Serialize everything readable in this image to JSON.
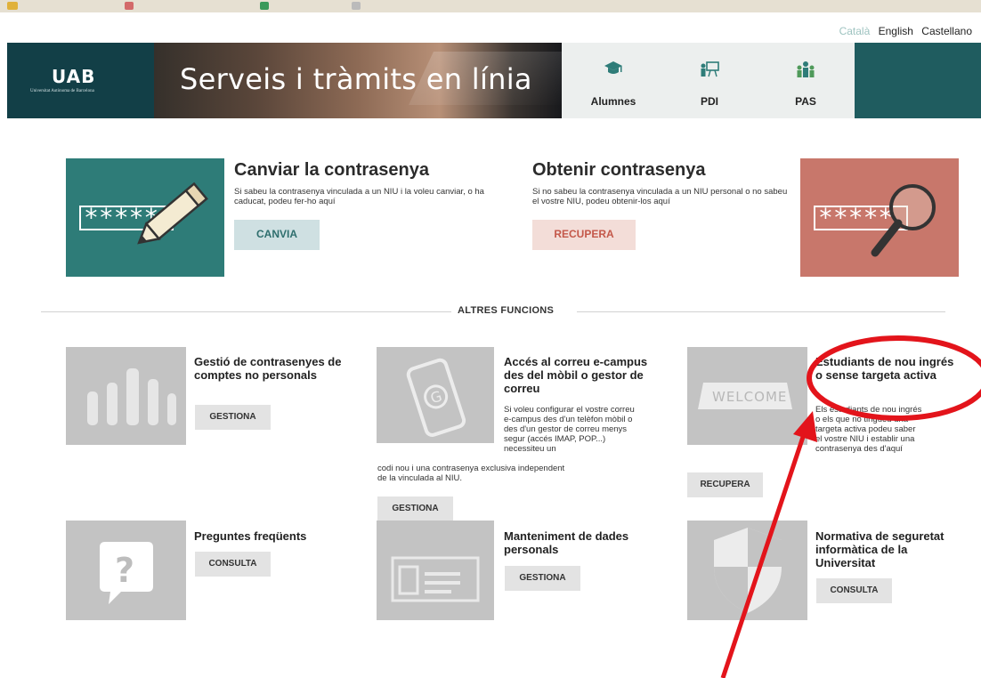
{
  "colors": {
    "teal_dark": "#123f47",
    "teal": "#2e7c78",
    "salmon": "#c8776b",
    "grey_tile": "#c3c3c3",
    "annotation_red": "#e3141b"
  },
  "languages": [
    {
      "label": "Català",
      "active": true
    },
    {
      "label": "English",
      "active": false
    },
    {
      "label": "Castellano",
      "active": false
    }
  ],
  "header": {
    "logo": "UAB",
    "logo_sub": "Universitat Autònoma de Barcelona",
    "title": "Serveis i tràmits en línia",
    "nav": [
      {
        "label": "Alumnes",
        "icon": "graduation-cap-icon"
      },
      {
        "label": "PDI",
        "icon": "teacher-board-icon"
      },
      {
        "label": "PAS",
        "icon": "staff-group-icon"
      }
    ]
  },
  "primary": {
    "canviar": {
      "title": "Canviar la contrasenya",
      "desc": "Si sabeu la contrasenya vinculada a un NIU i la voleu canviar, o ha caducat, podeu fer-ho aquí",
      "button": "CANVIA",
      "image_text": "*****"
    },
    "obtenir": {
      "title": "Obtenir contrasenya",
      "desc": "Si no sabeu la contrasenya vinculada a un NIU personal o no sabeu el vostre NIU, podeu obtenir-los aquí",
      "button": "RECUPERA",
      "image_text": "*****"
    }
  },
  "divider": "ALTRES FUNCIONS",
  "functions": {
    "gestio": {
      "title": "Gestió de contrasenyes de comptes no personals",
      "button": "GESTIONA"
    },
    "correu": {
      "title": "Accés al correu e-campus des del mòbil o gestor de correu",
      "desc": "Si voleu configurar el vostre correu e-campus des d'un telèfon mòbil o des d'un gestor de correu menys segur (accés IMAP, POP...) necessiteu un",
      "desc2": "codi nou i una contrasenya exclusiva independent de la vinculada al NIU.",
      "button": "GESTIONA"
    },
    "estudiants": {
      "title": "Estudiants de nou ingrés o sense targeta activa",
      "desc": "Els estudiants de nou ingrés o els que no tingueu una targeta activa podeu saber el vostre NIU i establir una contrasenya des d'aquí",
      "button": "RECUPERA",
      "image_text": "WELCOME"
    },
    "preguntes": {
      "title": "Preguntes freqüents",
      "button": "CONSULTA"
    },
    "manteniment": {
      "title": "Manteniment de dades personals",
      "button": "GESTIONA"
    },
    "normativa": {
      "title": "Normativa de seguretat informàtica de la Universitat",
      "button": "CONSULTA"
    }
  }
}
